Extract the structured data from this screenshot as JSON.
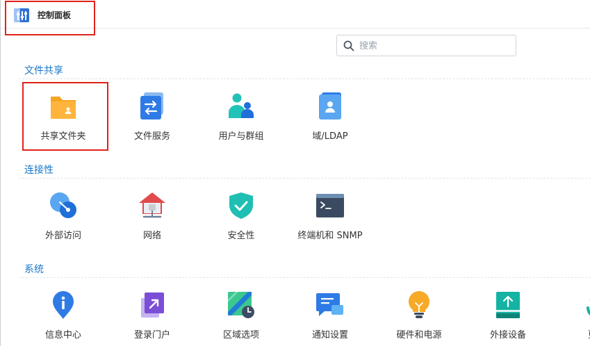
{
  "window": {
    "title": "控制面板"
  },
  "search": {
    "placeholder": "搜索"
  },
  "sections": [
    {
      "title": "文件共享",
      "items": [
        {
          "label": "共享文件夹",
          "icon": "shared-folder-icon"
        },
        {
          "label": "文件服务",
          "icon": "file-services-icon"
        },
        {
          "label": "用户与群组",
          "icon": "user-group-icon"
        },
        {
          "label": "域/LDAP",
          "icon": "domain-ldap-icon"
        }
      ]
    },
    {
      "title": "连接性",
      "items": [
        {
          "label": "外部访问",
          "icon": "external-access-icon"
        },
        {
          "label": "网络",
          "icon": "network-icon"
        },
        {
          "label": "安全性",
          "icon": "security-shield-icon"
        },
        {
          "label": "终端机和 SNMP",
          "icon": "terminal-icon"
        }
      ]
    },
    {
      "title": "系统",
      "items": [
        {
          "label": "信息中心",
          "icon": "info-center-icon"
        },
        {
          "label": "登录门户",
          "icon": "login-portal-icon"
        },
        {
          "label": "区域选项",
          "icon": "regional-options-icon"
        },
        {
          "label": "通知设置",
          "icon": "notification-icon"
        },
        {
          "label": "硬件和电源",
          "icon": "hardware-power-icon"
        },
        {
          "label": "外接设备",
          "icon": "external-devices-icon"
        },
        {
          "label": "更新",
          "icon": "update-restore-icon"
        }
      ]
    }
  ],
  "colors": {
    "accent": "#1877c8",
    "highlight": "#e0211b"
  }
}
